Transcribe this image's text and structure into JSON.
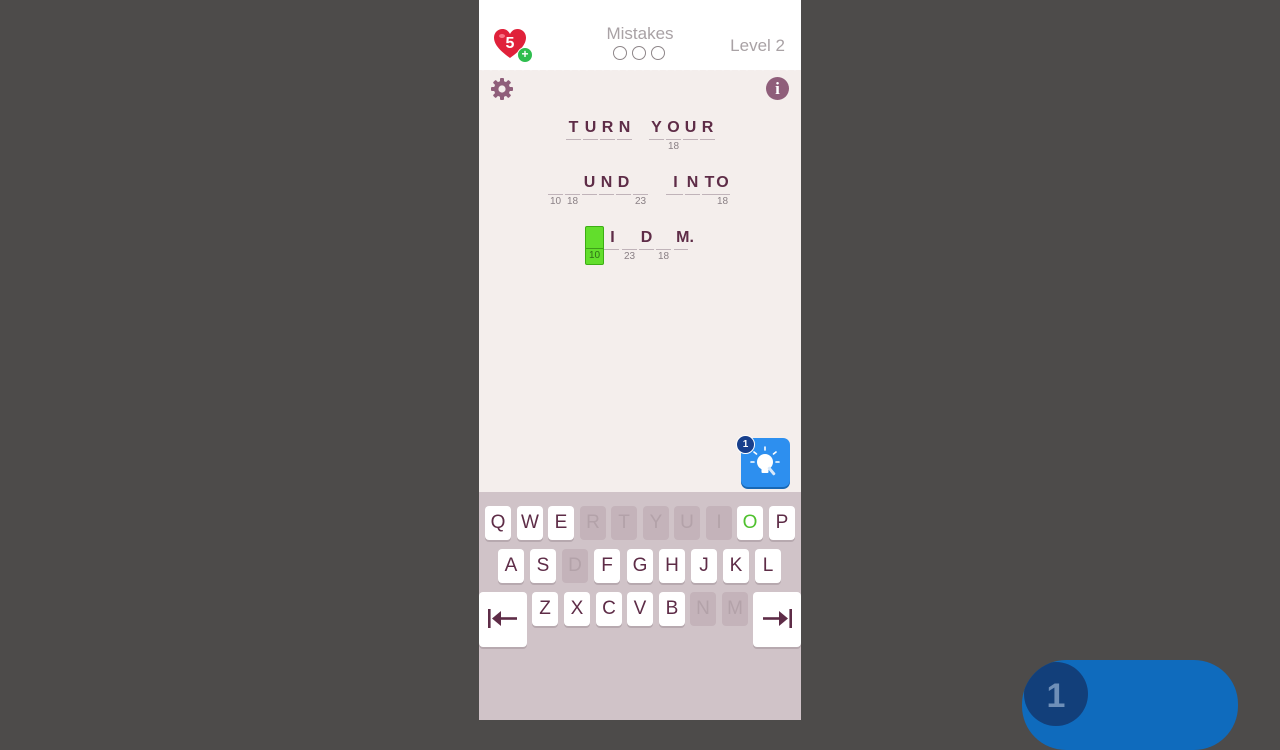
{
  "header": {
    "lives": "5",
    "lives_plus": "+",
    "mistakes_label": "Mistakes",
    "mistakes_total": 3,
    "mistakes_made": 0,
    "level": "Level 2"
  },
  "toolbar": {
    "settings_icon": "gear-icon",
    "info_icon": "info-icon",
    "info_glyph": "i"
  },
  "puzzle": {
    "line1": {
      "word1": {
        "c0": {
          "char": "T",
          "num": ""
        },
        "c1": {
          "char": "U",
          "num": ""
        },
        "c2": {
          "char": "R",
          "num": ""
        },
        "c3": {
          "char": "N",
          "num": ""
        }
      },
      "word2": {
        "c0": {
          "char": "Y",
          "num": ""
        },
        "c1": {
          "char": "O",
          "num": "18"
        },
        "c2": {
          "char": "U",
          "num": ""
        },
        "c3": {
          "char": "R",
          "num": ""
        }
      }
    },
    "line2": {
      "word1": {
        "c0": {
          "char": "",
          "num": "10"
        },
        "c1": {
          "char": "",
          "num": "18"
        },
        "c2": {
          "char": "U",
          "num": ""
        },
        "c3": {
          "char": "N",
          "num": ""
        },
        "c4": {
          "char": "D",
          "num": ""
        },
        "c5": {
          "char": "",
          "num": "23"
        }
      },
      "word2": {
        "c0": {
          "char": "",
          "num": ""
        },
        "c1": {
          "char": "I",
          "num": ""
        },
        "c2": {
          "char": "N",
          "num": ""
        },
        "c3": {
          "char": "T",
          "num": ""
        },
        "c4": {
          "char": "O",
          "num": "18"
        }
      }
    },
    "line3": {
      "word1": {
        "c0": {
          "char": "",
          "num": "10"
        },
        "c1": {
          "char": "",
          "num": ""
        },
        "c2": {
          "char": "I",
          "num": ""
        },
        "c3": {
          "char": "",
          "num": "23"
        },
        "c4": {
          "char": "D",
          "num": ""
        },
        "c5": {
          "char": "",
          "num": "18"
        },
        "c6": {
          "char": "M.",
          "num": ""
        }
      }
    }
  },
  "hint": {
    "count": "1",
    "icon": "lightbulb-icon"
  },
  "keyboard": {
    "row1": [
      {
        "key": "Q",
        "state": "available"
      },
      {
        "key": "W",
        "state": "available"
      },
      {
        "key": "E",
        "state": "available"
      },
      {
        "key": "R",
        "state": "used"
      },
      {
        "key": "T",
        "state": "used"
      },
      {
        "key": "Y",
        "state": "used"
      },
      {
        "key": "U",
        "state": "used"
      },
      {
        "key": "I",
        "state": "used"
      },
      {
        "key": "O",
        "state": "hinted"
      },
      {
        "key": "P",
        "state": "available"
      }
    ],
    "row2": [
      {
        "key": "A",
        "state": "available"
      },
      {
        "key": "S",
        "state": "available"
      },
      {
        "key": "D",
        "state": "used"
      },
      {
        "key": "F",
        "state": "available"
      },
      {
        "key": "G",
        "state": "available"
      },
      {
        "key": "H",
        "state": "available"
      },
      {
        "key": "J",
        "state": "available"
      },
      {
        "key": "K",
        "state": "available"
      },
      {
        "key": "L",
        "state": "available"
      }
    ],
    "row3": [
      {
        "key": "Z",
        "state": "available"
      },
      {
        "key": "X",
        "state": "available"
      },
      {
        "key": "C",
        "state": "available"
      },
      {
        "key": "V",
        "state": "available"
      },
      {
        "key": "B",
        "state": "available"
      },
      {
        "key": "N",
        "state": "used"
      },
      {
        "key": "M",
        "state": "used"
      }
    ],
    "prev_icon": "arrow-to-start-icon",
    "next_icon": "arrow-to-end-icon"
  },
  "overlay": {
    "badge_number": "1"
  },
  "colors": {
    "letter": "#5e2c47",
    "active_cell": "#62de2c",
    "hinted_key": "#4fc12e",
    "hint_button": "#2d8fef",
    "heart": "#e0213a",
    "info": "#8f5e7a"
  }
}
